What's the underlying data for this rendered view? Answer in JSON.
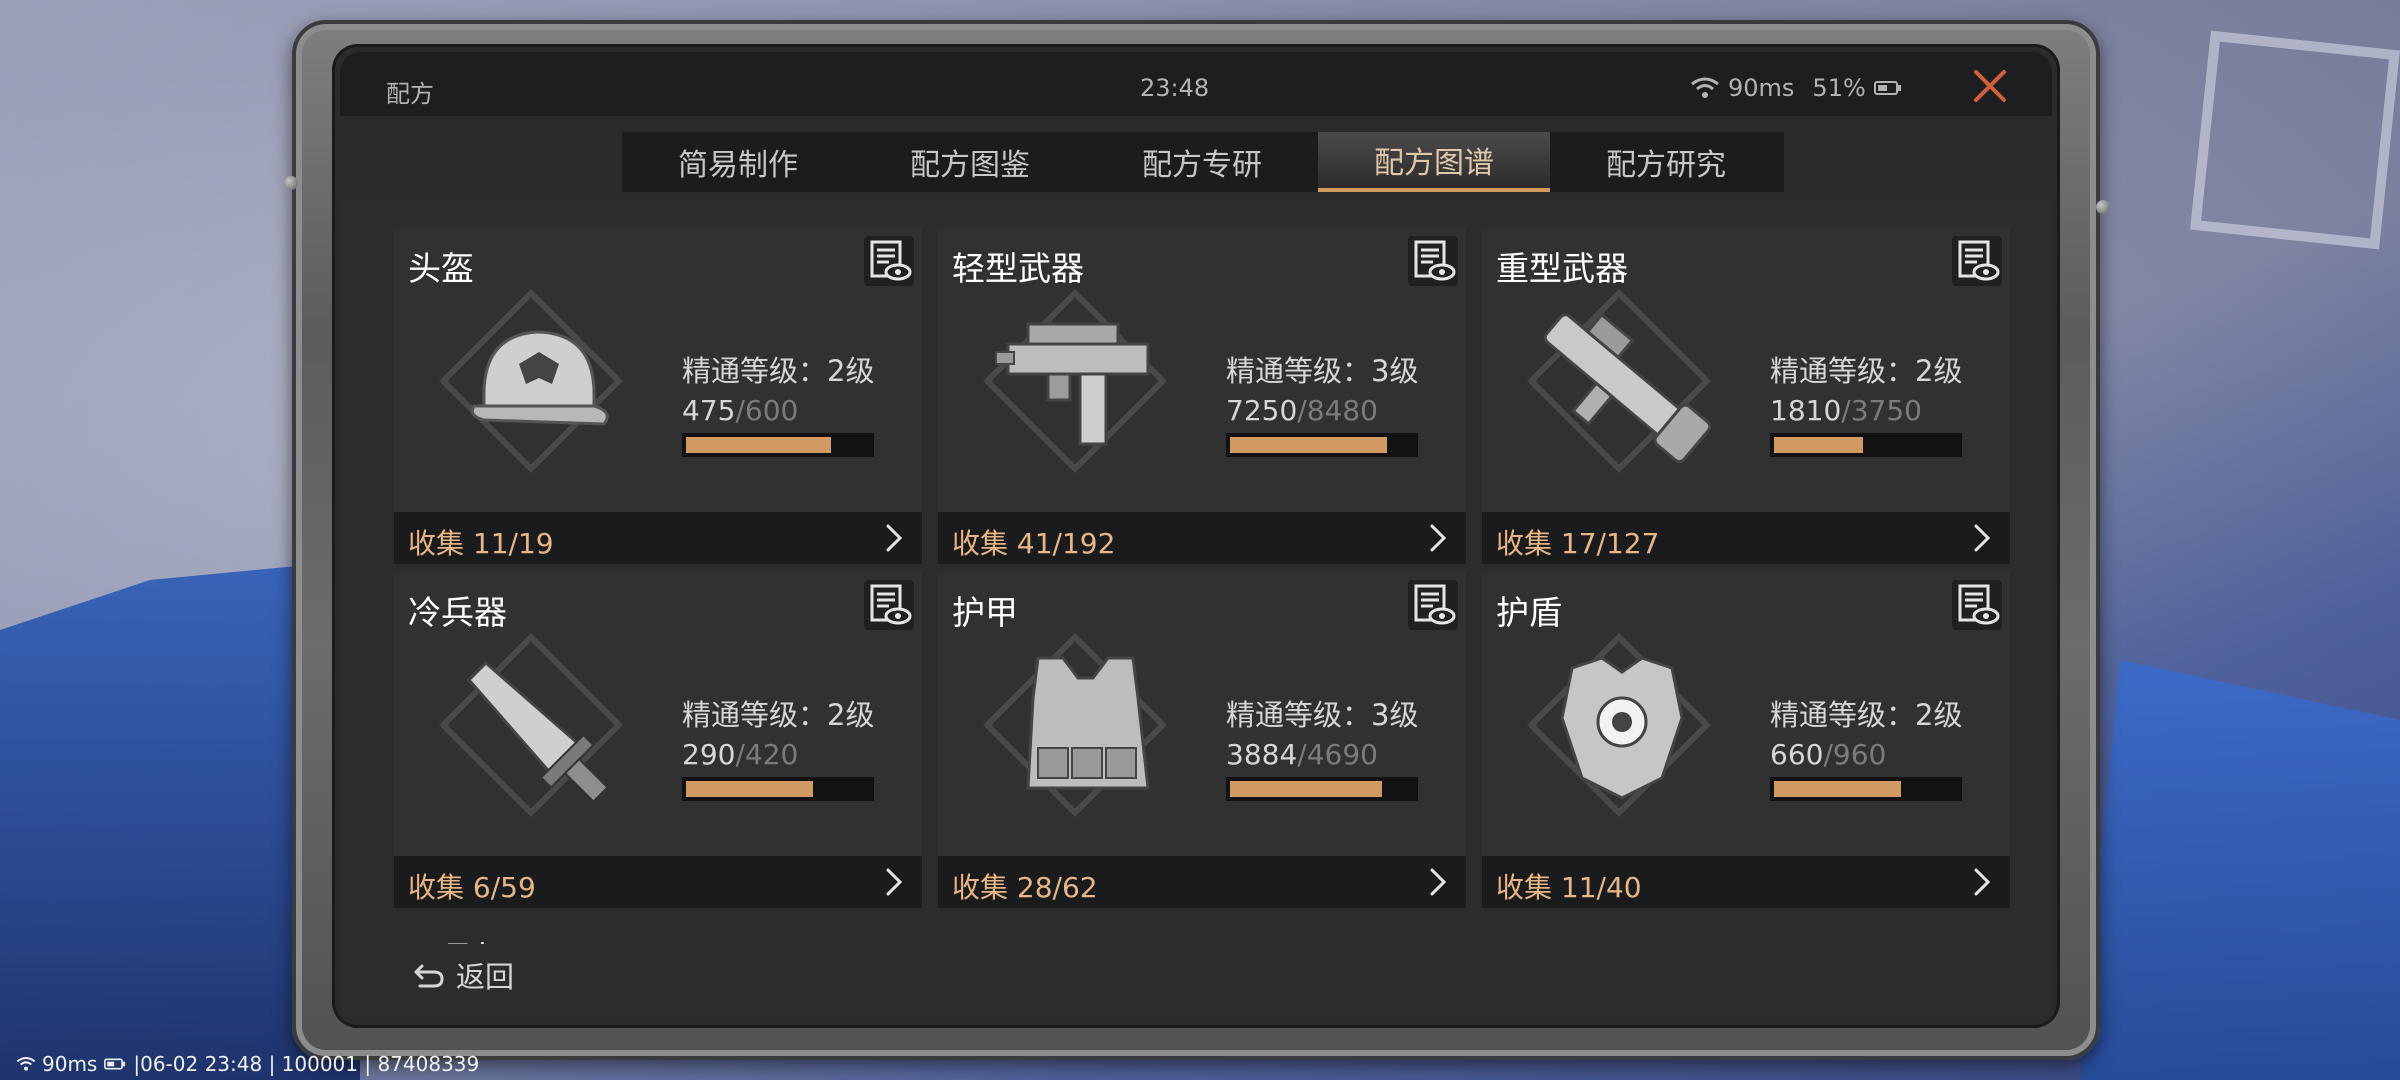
{
  "window": {
    "title": "配方",
    "clock": "23:48",
    "ping": "90ms",
    "battery": "51%"
  },
  "tabs": [
    {
      "label": "简易制作",
      "active": false
    },
    {
      "label": "配方图鉴",
      "active": false
    },
    {
      "label": "配方专研",
      "active": false
    },
    {
      "label": "配方图谱",
      "active": true
    },
    {
      "label": "配方研究",
      "active": false
    }
  ],
  "cards": [
    {
      "name": "头盔",
      "icon": "cap-icon",
      "mastery": "精通等级：2级",
      "current": "475",
      "max": "600",
      "progress": 0.79,
      "collect": "收集 11/19"
    },
    {
      "name": "轻型武器",
      "icon": "smg-icon",
      "mastery": "精通等级：3级",
      "current": "7250",
      "max": "8480",
      "progress": 0.855,
      "collect": "收集 41/192"
    },
    {
      "name": "重型武器",
      "icon": "rocket-launcher-icon",
      "mastery": "精通等级：2级",
      "current": "1810",
      "max": "3750",
      "progress": 0.483,
      "collect": "收集 17/127"
    },
    {
      "name": "冷兵器",
      "icon": "knife-icon",
      "mastery": "精通等级：2级",
      "current": "290",
      "max": "420",
      "progress": 0.69,
      "collect": "收集 6/59"
    },
    {
      "name": "护甲",
      "icon": "vest-icon",
      "mastery": "精通等级：3级",
      "current": "3884",
      "max": "4690",
      "progress": 0.828,
      "collect": "收集 28/62"
    },
    {
      "name": "护盾",
      "icon": "shield-armor-icon",
      "mastery": "精通等级：2级",
      "current": "660",
      "max": "960",
      "progress": 0.6875,
      "collect": "收集 11/40"
    }
  ],
  "partial_card": {
    "name": "工具机"
  },
  "back_label": "返回",
  "footer": {
    "ping": "90ms",
    "info": "|06-02 23:48 | 100001 | 87408339"
  },
  "colors": {
    "accent": "#d29a63",
    "collect_text": "#e8b686",
    "active_tab_text": "#e2c8a8"
  }
}
